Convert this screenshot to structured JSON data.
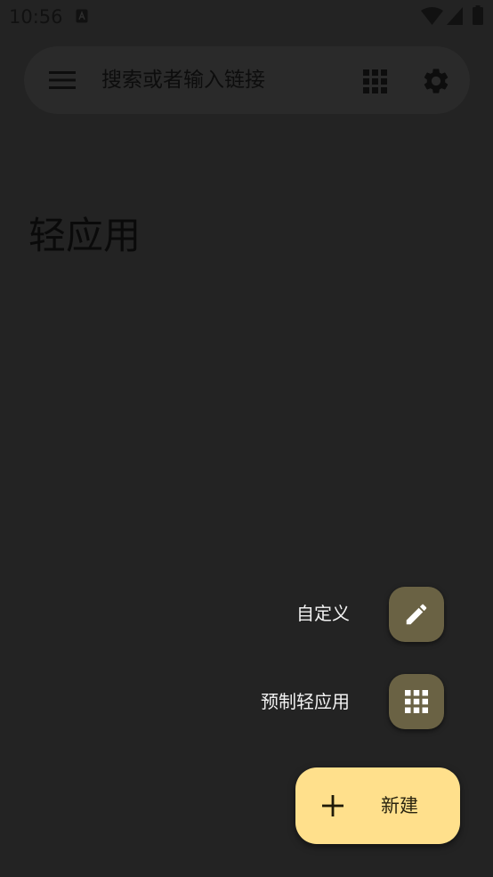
{
  "status_bar": {
    "time": "10:56",
    "icons": [
      "app-notification-icon",
      "wifi-icon",
      "signal-icon",
      "battery-icon"
    ]
  },
  "search_bar": {
    "placeholder": "搜索或者输入链接",
    "icons": [
      "menu-icon",
      "apps-grid-icon",
      "gear-icon"
    ]
  },
  "page": {
    "title": "轻应用"
  },
  "speed_dial": {
    "items": [
      {
        "label": "自定义",
        "icon": "pencil-icon"
      },
      {
        "label": "预制轻应用",
        "icon": "apps-grid-icon"
      }
    ],
    "main_fab": {
      "label": "新建",
      "icon": "plus-icon"
    }
  },
  "colors": {
    "background": "#232323",
    "search_bar": "#2a2a2a",
    "mini_fab": "#6a6244",
    "main_fab": "#ffe08c",
    "dark_text": "#0d0d0d",
    "light_text": "#f2f2f2"
  }
}
